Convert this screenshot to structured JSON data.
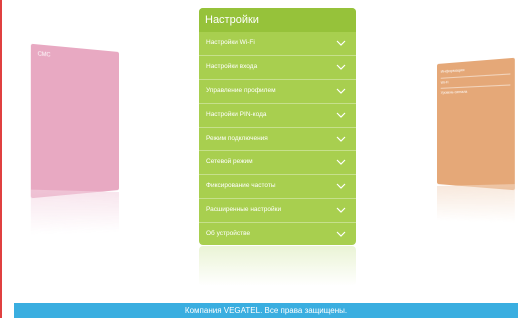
{
  "left_card": {
    "title": "СМС"
  },
  "right_card": {
    "title": "Информация",
    "rows": [
      {
        "label": "Wi-Fi",
        "value": ""
      },
      {
        "label": "Уровень сигнала",
        "value": ""
      }
    ]
  },
  "settings_panel": {
    "title": "Настройки",
    "items": [
      {
        "label": "Настройки Wi-Fi"
      },
      {
        "label": "Настройки входа"
      },
      {
        "label": "Управление профилем"
      },
      {
        "label": "Настройки PIN-кода"
      },
      {
        "label": "Режим подключения"
      },
      {
        "label": "Сетевой режим"
      },
      {
        "label": "Фиксирование частоты"
      },
      {
        "label": "Расширенные настройки"
      },
      {
        "label": "Об устройстве"
      }
    ]
  },
  "footer": {
    "text": "Компания VEGATEL. Все права защищены."
  },
  "colors": {
    "panel": "#a8cf4f",
    "panel_header": "#96c23a",
    "left_card": "#e8a9c2",
    "right_card": "#e5a878",
    "footer": "#3aaee0"
  }
}
